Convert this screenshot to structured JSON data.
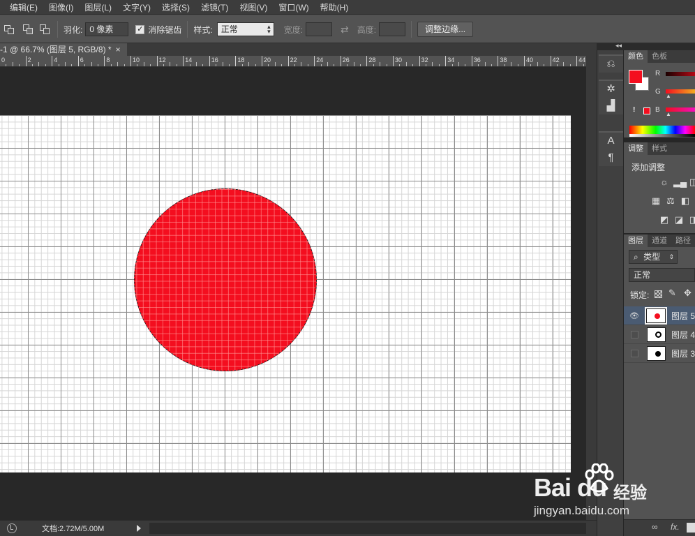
{
  "menu": [
    "编辑(E)",
    "图像(I)",
    "图层(L)",
    "文字(Y)",
    "选择(S)",
    "滤镜(T)",
    "视图(V)",
    "窗口(W)",
    "帮助(H)"
  ],
  "options": {
    "feather_label": "羽化:",
    "feather_value": "0 像素",
    "antialias_label": "消除锯齿",
    "antialias_checked": "✓",
    "style_label": "样式:",
    "style_value": "正常",
    "width_label": "宽度:",
    "height_label": "高度:",
    "refine_edge_button": "调整边缘..."
  },
  "document_tab": {
    "title": "-1 @ 66.7% (图层 5, RGB/8) *",
    "close": "×"
  },
  "ruler_labels": [
    "0",
    "2",
    "4",
    "6",
    "8",
    "10",
    "12",
    "14",
    "16",
    "18",
    "20",
    "22",
    "24",
    "26",
    "28",
    "30",
    "32",
    "34",
    "36",
    "38",
    "40",
    "42",
    "44"
  ],
  "status": {
    "doc_size": "文档:2.72M/5.00M"
  },
  "panels": {
    "collapse": "◂◂",
    "color": {
      "tabs": [
        "颜色",
        "色板"
      ],
      "labels": [
        "R",
        "G",
        "B"
      ],
      "warning": "!",
      "fg_color": "#f40e1f",
      "bg_color": "#ffffff"
    },
    "adjustments": {
      "tabs": [
        "调整",
        "样式"
      ],
      "title": "添加调整"
    },
    "layers": {
      "tabs": [
        "图层",
        "通道",
        "路径"
      ],
      "filter_value": "类型",
      "filter_icon": "⌕",
      "blend_mode": "正常",
      "lock_label": "锁定:",
      "rows": [
        {
          "name": "图层 5",
          "visible": "👁",
          "thumb_color": "#f40e1f"
        },
        {
          "name": "图层 4",
          "visible": "",
          "thumb_color": "#000000"
        },
        {
          "name": "图层 3",
          "visible": "",
          "thumb_color": "#000000"
        }
      ],
      "bottom_icons": [
        "∞",
        "fx."
      ]
    }
  },
  "watermark": {
    "brand": "Bai  du",
    "cn": "经验",
    "url": "jingyan.baidu.com"
  },
  "accent_red": "#f40e1f"
}
